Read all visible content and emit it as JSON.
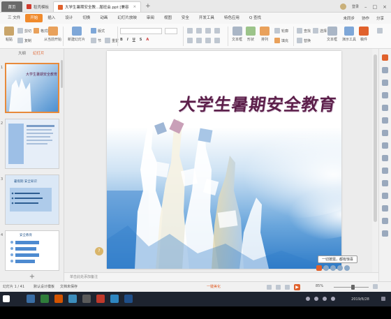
{
  "titlebar": {
    "home_tab": "首页",
    "tabs": [
      {
        "label": "稻壳模板",
        "active": false
      },
      {
        "label": "大学生暑期安全教...届班会.ppt [兼容",
        "active": true
      }
    ],
    "new_tab": "+",
    "user": "登录"
  },
  "ribbon_tabs": {
    "file": "三 文件",
    "items": [
      "开始",
      "插入",
      "设计",
      "切换",
      "动画",
      "幻灯片放映",
      "审阅",
      "视图",
      "安全",
      "开发工具",
      "特色应用"
    ],
    "active_index": 0,
    "search": "Q 查找",
    "right": [
      "未同步",
      "协作",
      "分享"
    ]
  },
  "ribbon": {
    "paste": "粘贴",
    "cut": "剪切",
    "copy": "复制",
    "format_painter": "格式刷",
    "from_start": "从当前开始",
    "new_slide": "新建幻灯片",
    "layout": "版式",
    "section": "节",
    "reset": "重置",
    "text_box": "文本框",
    "shapes": "形状",
    "arrange": "排列",
    "outline": "轮廓",
    "fill": "填充",
    "find": "查找",
    "replace": "替换",
    "select": "选择",
    "smart_art": "文本框",
    "present": "演示工具",
    "wps_cloud": "稿件",
    "font_color": "A",
    "zoom_label": "缩放"
  },
  "leftpane": {
    "tab_outline": "大纲",
    "tab_slides": "幻灯片",
    "slide_numbers": [
      "1",
      "2",
      "3",
      "4"
    ],
    "add_slide": "+",
    "thumb3_title": "暑假期 安全知识",
    "thumb4_title": "安全教育"
  },
  "slide": {
    "title": "大学生暑期安全教育"
  },
  "editor": {
    "notes_placeholder": "单击此处添加备注",
    "tooltip": "一切按需，都有惊喜"
  },
  "statusbar": {
    "slide_counter": "幻灯片 1 / 41",
    "theme": "默认设计模板",
    "missing_font": "文档未保存",
    "beautify": "一键美化",
    "zoom": "85%"
  },
  "taskbar": {
    "date_time": "2019/6/28"
  }
}
